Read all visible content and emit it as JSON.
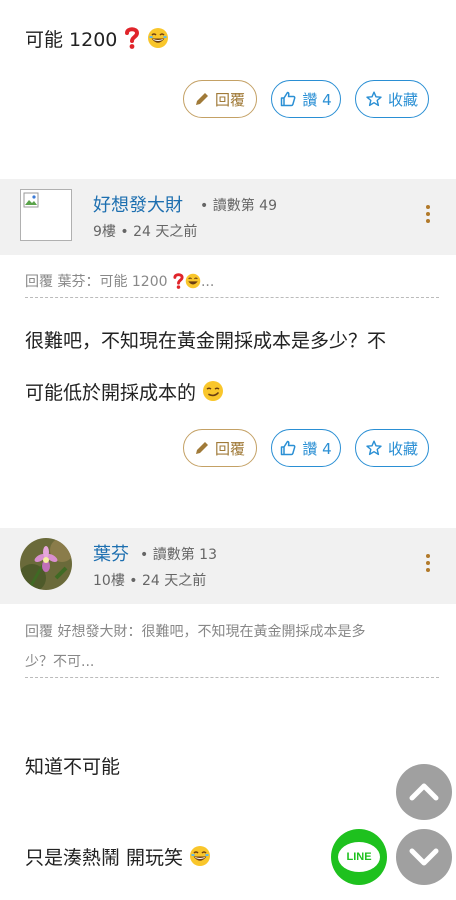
{
  "post1": {
    "text": "可能 1200 ",
    "icons": [
      "red-question-mark-icon",
      "laughing-emoji-icon"
    ]
  },
  "actions": {
    "reply_label": "回覆",
    "like_label": "讚 4",
    "fav_label": "收藏"
  },
  "comments": [
    {
      "username": "好想發大財",
      "read_count": "• 讀數第 49",
      "floor": "9樓 •  24 天之前",
      "avatar": "broken-image",
      "quote": "回覆 葉芬：可能 1200 ",
      "quote_suffix": "...",
      "body_line1": "很難吧，不知現在黃金開採成本是多少？不",
      "body_line2": "可能低於開採成本的"
    },
    {
      "username": "葉芬",
      "read_count": "• 讀數第 13",
      "floor": "10樓 •  24 天之前",
      "avatar": "flower-photo",
      "quote_line1": "回覆 好想發大財：很難吧，不知現在黃金開採成本是多",
      "quote_line2": "少？不可...",
      "body_line1": "知道不可能",
      "body_line2": "只是湊熱鬧 開玩笑"
    }
  ],
  "floating": {
    "scroll_up": "chevron-up-icon",
    "scroll_down": "chevron-down-icon",
    "line_label": "LINE"
  },
  "colors": {
    "reply_gold": "#c4a165",
    "blue": "#2a8fd4",
    "username_blue": "#1d6fb0",
    "line_green": "#1ec11e"
  }
}
